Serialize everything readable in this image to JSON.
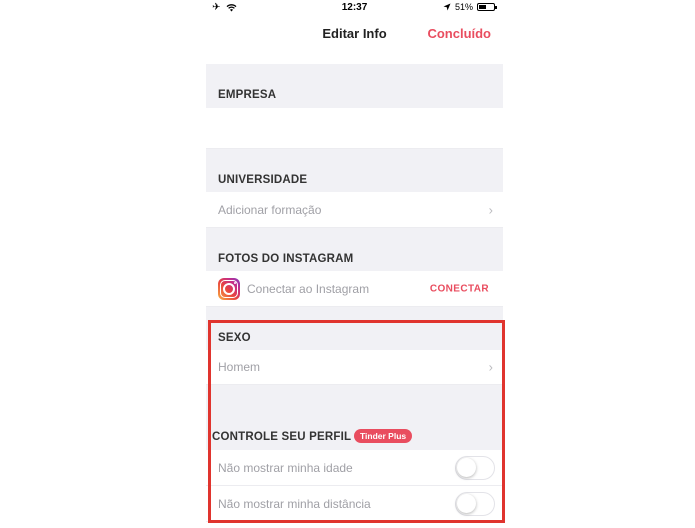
{
  "status_bar": {
    "time": "12:37",
    "battery_percent": "51%",
    "battery_level": 0.51
  },
  "nav": {
    "title": "Editar Info",
    "done_label": "Concluído"
  },
  "sections": {
    "empresa": {
      "title": "EMPRESA"
    },
    "universidade": {
      "title": "UNIVERSIDADE",
      "row_label": "Adicionar formação"
    },
    "instagram": {
      "title": "FOTOS DO INSTAGRAM",
      "row_label": "Conectar ao Instagram",
      "action_label": "CONECTAR"
    },
    "sexo": {
      "title": "SEXO",
      "row_label": "Homem"
    },
    "controle": {
      "title": "CONTROLE SEU PERFIL",
      "badge": "Tinder Plus",
      "options": [
        {
          "label": "Não mostrar minha idade",
          "enabled": false
        },
        {
          "label": "Não mostrar minha distância",
          "enabled": false
        }
      ]
    }
  },
  "colors": {
    "accent": "#e94d5f",
    "highlight": "#e0342e",
    "section_bg": "#f1f1f5"
  },
  "icons": {
    "chevron": "chevron-right-icon",
    "instagram": "instagram-icon"
  }
}
